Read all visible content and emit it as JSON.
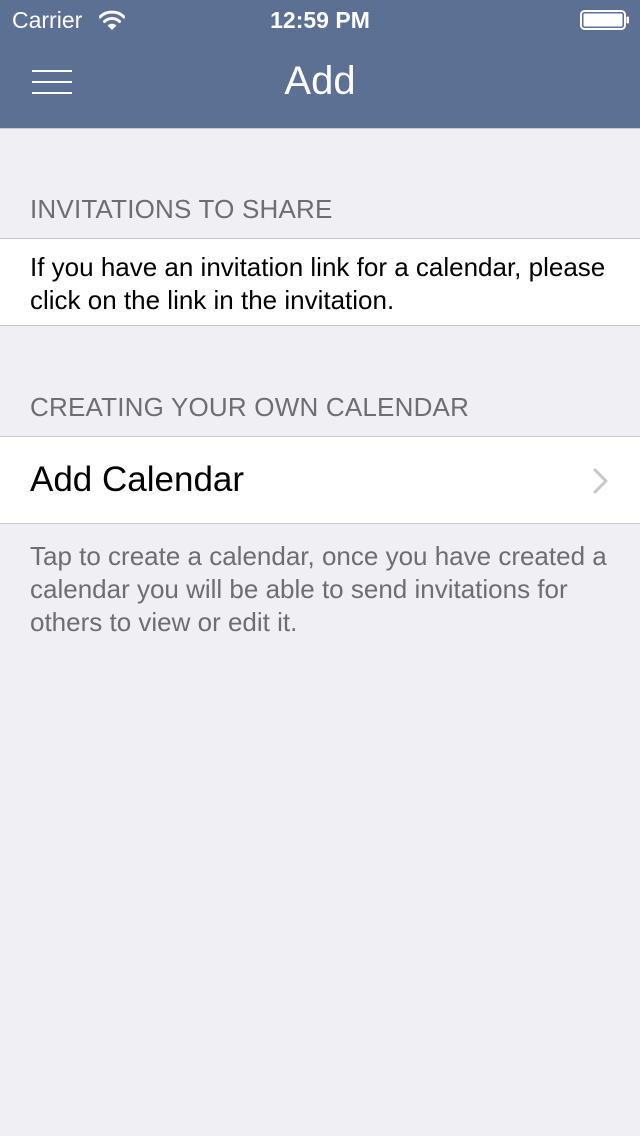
{
  "status_bar": {
    "carrier": "Carrier",
    "time": "12:59 PM",
    "wifi_icon": "wifi-icon",
    "battery_icon": "battery-icon"
  },
  "nav_bar": {
    "title": "Add",
    "menu_icon": "hamburger-menu-icon",
    "background_color": "#5b7092"
  },
  "sections": {
    "invitations": {
      "header": "INVITATIONS TO SHARE",
      "text": "If you have an invitation link for a calendar, please click on the link in the invitation."
    },
    "own_calendar": {
      "header": "CREATING YOUR OWN CALENDAR",
      "row_label": "Add Calendar",
      "row_icon": "chevron-right-icon",
      "footer": "Tap to create a calendar, once you have created a calendar you will be able to send invitations for others to view or edit it."
    }
  },
  "colors": {
    "background": "#efeff4",
    "section_header_text": "#6d6d72",
    "separator": "#c8c7cc",
    "chevron": "#c7c7cc"
  }
}
